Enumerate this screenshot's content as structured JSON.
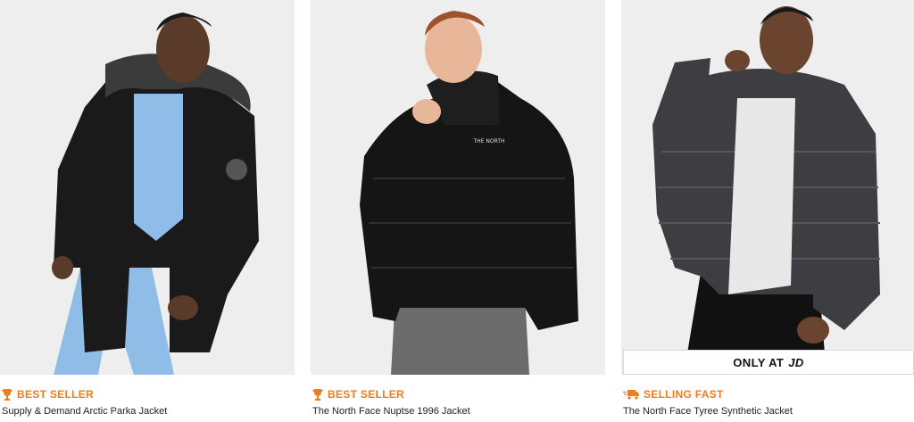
{
  "products": [
    {
      "badge": "BEST SELLER",
      "badge_icon": "trophy-icon",
      "name": "Supply & Demand Arctic Parka Jacket"
    },
    {
      "badge": "BEST SELLER",
      "badge_icon": "trophy-icon",
      "name": "The North Face Nuptse 1996 Jacket"
    },
    {
      "badge": "SELLING FAST",
      "badge_icon": "fast-delivery-icon",
      "name": "The North Face Tyree Synthetic Jacket",
      "exclusive_label": "ONLY AT",
      "exclusive_logo": "JD"
    }
  ],
  "colors": {
    "accent": "#f07c1b",
    "photo_bg": "#eeeeee"
  }
}
